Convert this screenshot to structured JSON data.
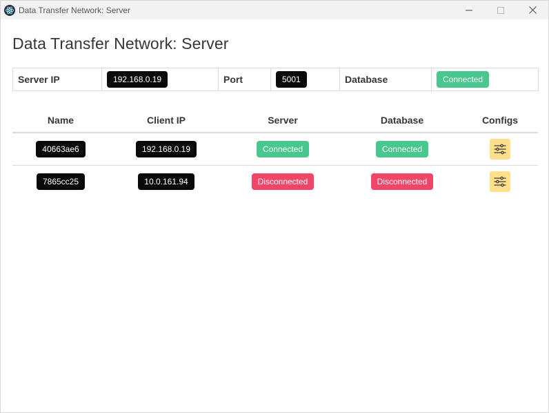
{
  "window": {
    "title": "Data Transfer Network: Server"
  },
  "page": {
    "heading": "Data Transfer Network: Server"
  },
  "server_info": {
    "ip_label": "Server IP",
    "ip_value": "192.168.0.19",
    "port_label": "Port",
    "port_value": "5001",
    "db_label": "Database",
    "db_status": "Connected"
  },
  "clients": {
    "headers": [
      "Name",
      "Client IP",
      "Server",
      "Database",
      "Configs"
    ],
    "rows": [
      {
        "name": "40663ae6",
        "client_ip": "192.168.0.19",
        "server": "Connected",
        "database": "Connected",
        "config_icon": "sliders-icon"
      },
      {
        "name": "7865cc25",
        "client_ip": "10.0.161.94",
        "server": "Disconnected",
        "database": "Disconnected",
        "config_icon": "sliders-icon"
      }
    ]
  },
  "colors": {
    "success": "#48c78e",
    "danger": "#f14668",
    "dark": "#0a0a0a",
    "warning": "#ffe08a"
  }
}
